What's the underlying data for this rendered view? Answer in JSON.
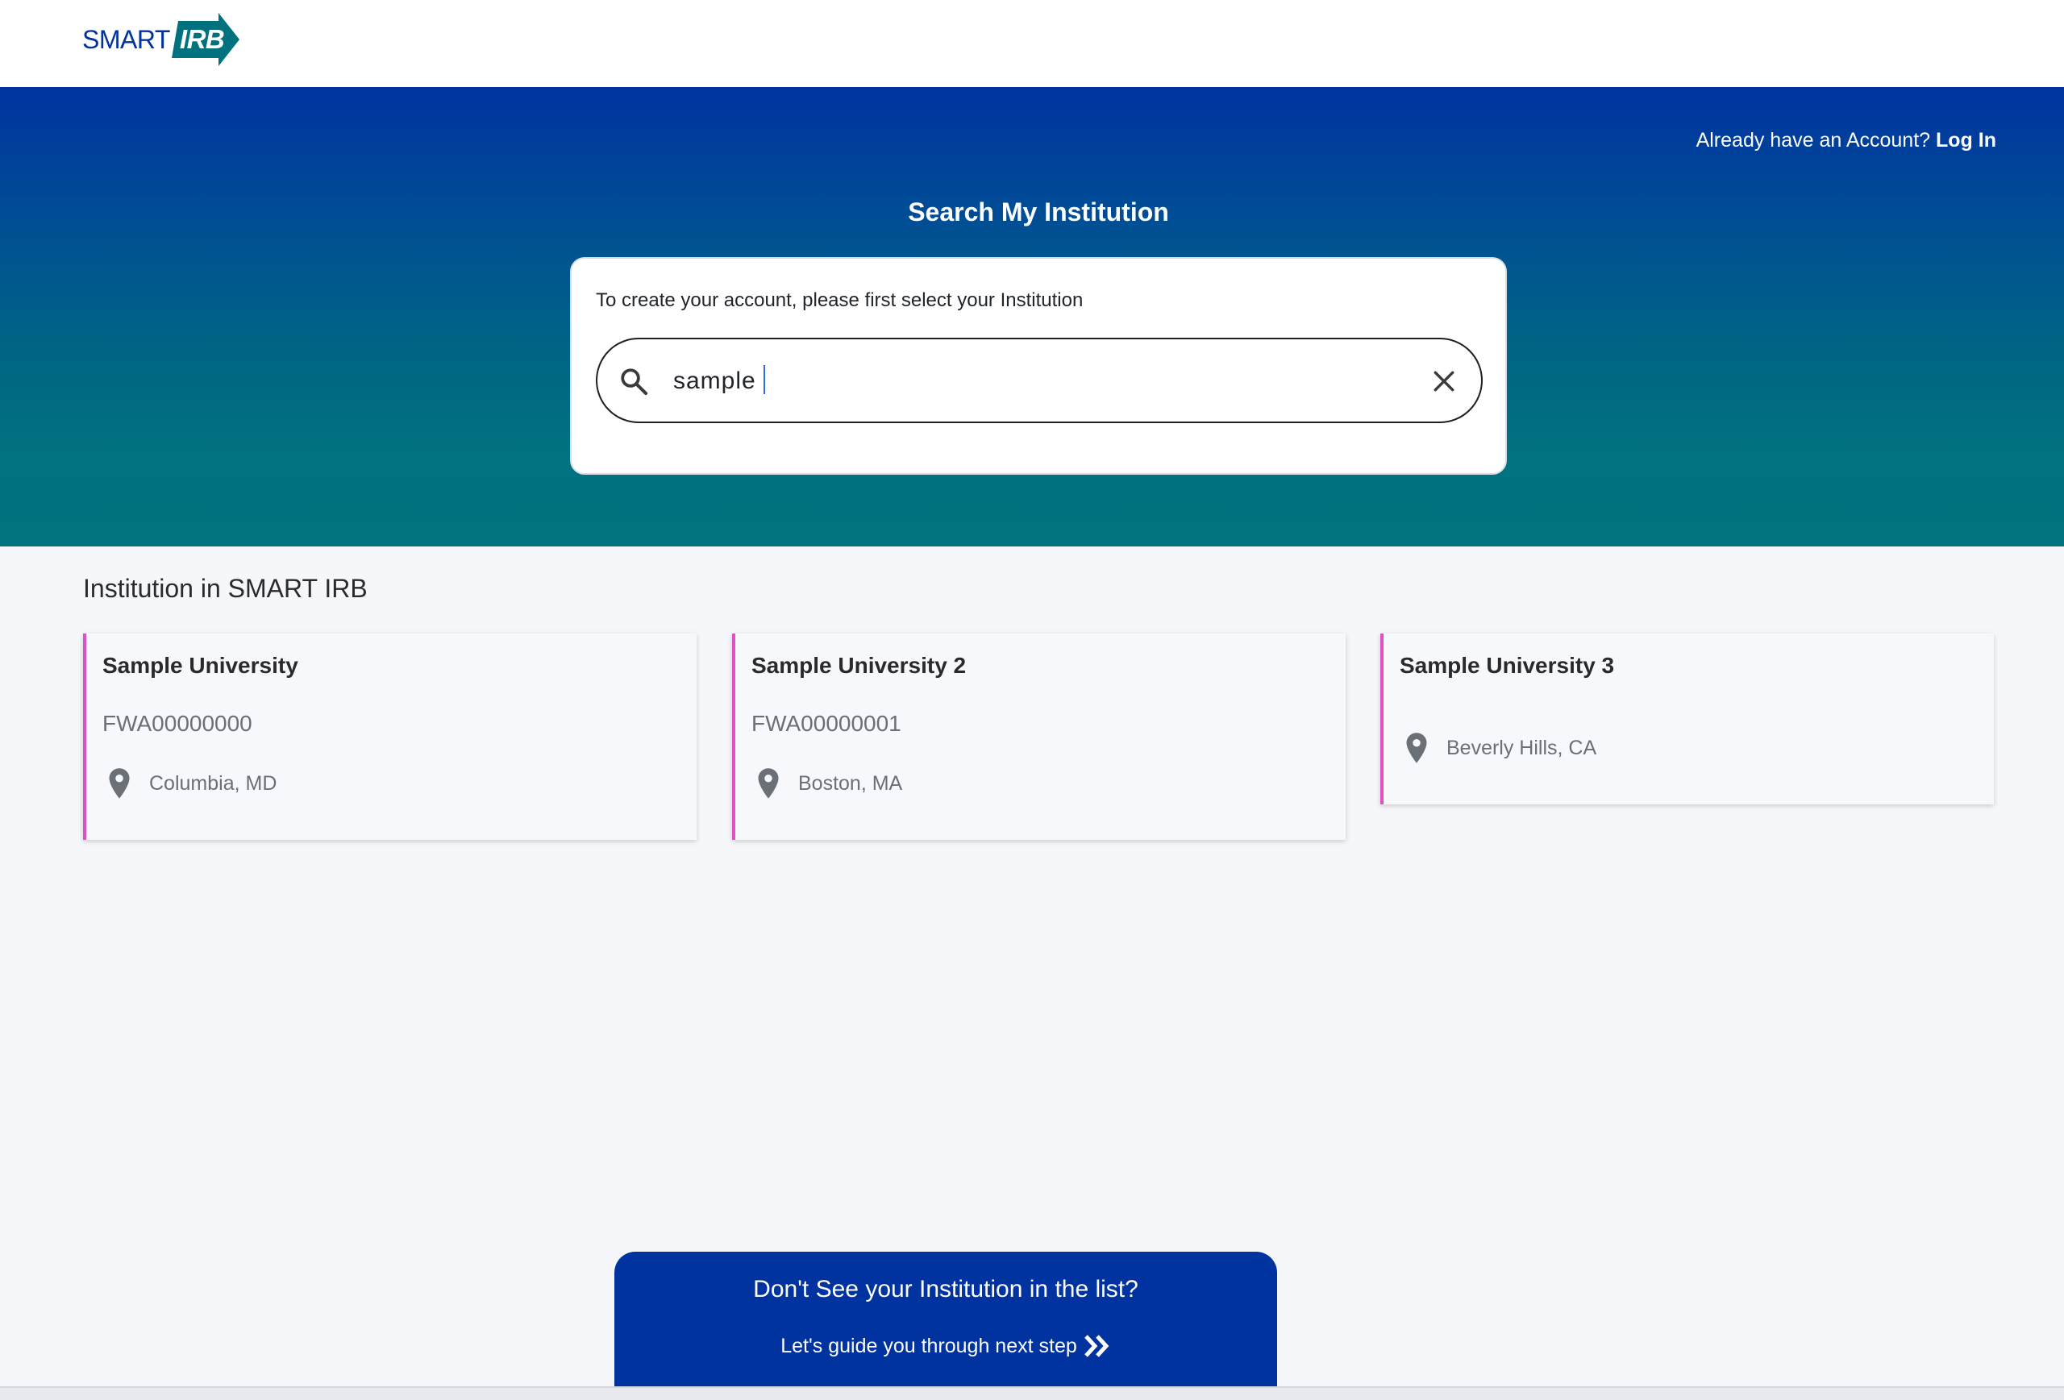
{
  "header": {
    "logo_smart": "SMART",
    "logo_irb": "IRB"
  },
  "hero": {
    "login_prompt": "Already have an Account?",
    "login_link": "Log In",
    "title": "Search My Institution",
    "search_hint": "To create your account, please first select your Institution",
    "search_value": "sample"
  },
  "results": {
    "heading": "Institution in SMART IRB",
    "cards": [
      {
        "name": "Sample University",
        "fwa": "FWA00000000",
        "location": "Columbia, MD"
      },
      {
        "name": "Sample University 2",
        "fwa": "FWA00000001",
        "location": "Boston, MA"
      },
      {
        "name": "Sample University 3",
        "fwa": "",
        "location": "Beverly Hills, CA"
      }
    ]
  },
  "cta": {
    "title": "Don't See your Institution in the list?",
    "subtitle": "Let's guide you through next step"
  },
  "icons": {
    "search": "search-icon",
    "clear": "close-icon",
    "location": "map-pin-icon",
    "next": "double-chevron-right-icon"
  },
  "colors": {
    "brand_blue": "#0033a0",
    "brand_teal": "#00737f",
    "card_accent": "#e04fc6"
  }
}
